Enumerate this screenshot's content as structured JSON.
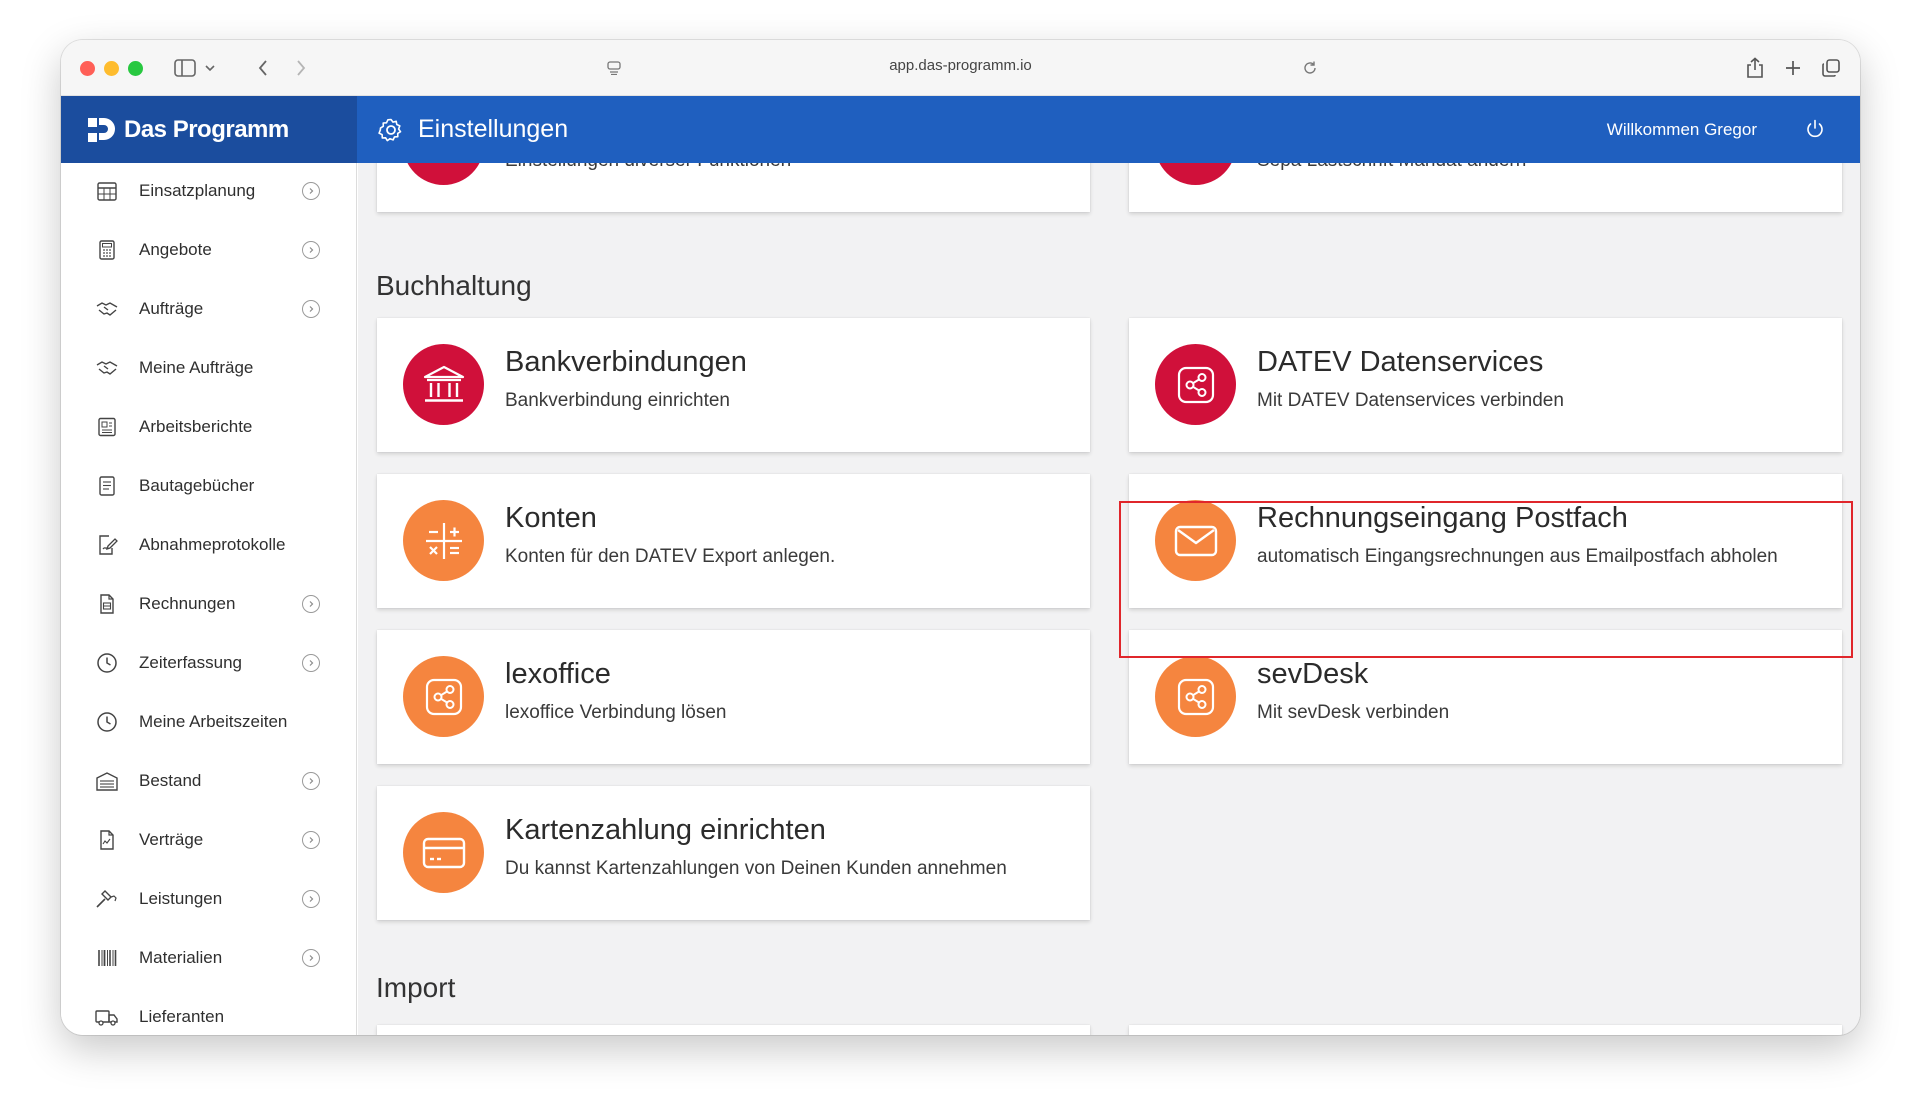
{
  "browser": {
    "url": "app.das-programm.io"
  },
  "header": {
    "logo": "Das Programm",
    "title": "Einstellungen",
    "welcome": "Willkommen Gregor"
  },
  "sidebar": {
    "items": [
      {
        "label": "Einsatzplanung",
        "icon": "calendar-grid-icon",
        "chevron": true
      },
      {
        "label": "Angebote",
        "icon": "calculator-icon",
        "chevron": true
      },
      {
        "label": "Aufträge",
        "icon": "handshake-icon",
        "chevron": true
      },
      {
        "label": "Meine Aufträge",
        "icon": "handshake-icon",
        "chevron": false
      },
      {
        "label": "Arbeitsberichte",
        "icon": "newspaper-icon",
        "chevron": false
      },
      {
        "label": "Bautagebücher",
        "icon": "notebook-icon",
        "chevron": false
      },
      {
        "label": "Abnahmeprotokolle",
        "icon": "document-signature-icon",
        "chevron": false
      },
      {
        "label": "Rechnungen",
        "icon": "invoice-icon",
        "chevron": true
      },
      {
        "label": "Zeiterfassung",
        "icon": "clock-icon",
        "chevron": true
      },
      {
        "label": "Meine Arbeitszeiten",
        "icon": "clock-icon",
        "chevron": false
      },
      {
        "label": "Bestand",
        "icon": "warehouse-icon",
        "chevron": true
      },
      {
        "label": "Verträge",
        "icon": "contract-icon",
        "chevron": true
      },
      {
        "label": "Leistungen",
        "icon": "hammer-icon",
        "chevron": true
      },
      {
        "label": "Materialien",
        "icon": "barcode-icon",
        "chevron": true
      },
      {
        "label": "Lieferanten",
        "icon": "truck-icon",
        "chevron": false
      }
    ]
  },
  "main": {
    "top_cards": [
      {
        "subtitle": "Einstellungen diverser Funktionen",
        "color": "#d0103a"
      },
      {
        "subtitle": "Sepa Lastschrift Mandat ändern",
        "color": "#d0103a"
      }
    ],
    "sections": [
      {
        "title": "Buchhaltung",
        "cards": [
          {
            "title": "Bankverbindungen",
            "subtitle": "Bankverbindung einrichten",
            "icon": "bank-icon",
            "color": "#d0103a"
          },
          {
            "title": "DATEV Datenservices",
            "subtitle": "Mit DATEV Datenservices verbinden",
            "icon": "share-icon",
            "color": "#d0103a"
          },
          {
            "title": "Konten",
            "subtitle": "Konten für den DATEV Export anlegen.",
            "icon": "math-operations-icon",
            "color": "#f5853f"
          },
          {
            "title": "Rechnungseingang Postfach",
            "subtitle": "automatisch Eingangsrechnungen aus Emailpostfach abholen",
            "icon": "envelope-icon",
            "color": "#f5853f",
            "highlighted": true
          },
          {
            "title": "lexoffice",
            "subtitle": "lexoffice Verbindung lösen",
            "icon": "share-icon",
            "color": "#f5853f"
          },
          {
            "title": "sevDesk",
            "subtitle": "Mit sevDesk verbinden",
            "icon": "share-icon",
            "color": "#f5853f"
          },
          {
            "title": "Kartenzahlung einrichten",
            "subtitle": "Du kannst Kartenzahlungen von Deinen Kunden annehmen",
            "icon": "credit-card-icon",
            "color": "#f5853f"
          }
        ]
      },
      {
        "title": "Import",
        "cards": []
      }
    ]
  },
  "colors": {
    "header_blue": "#1f5fbf",
    "logo_blue": "#1b4d9e",
    "accent_red": "#d0103a",
    "accent_orange": "#f5853f",
    "highlight_border": "#e0262b"
  }
}
